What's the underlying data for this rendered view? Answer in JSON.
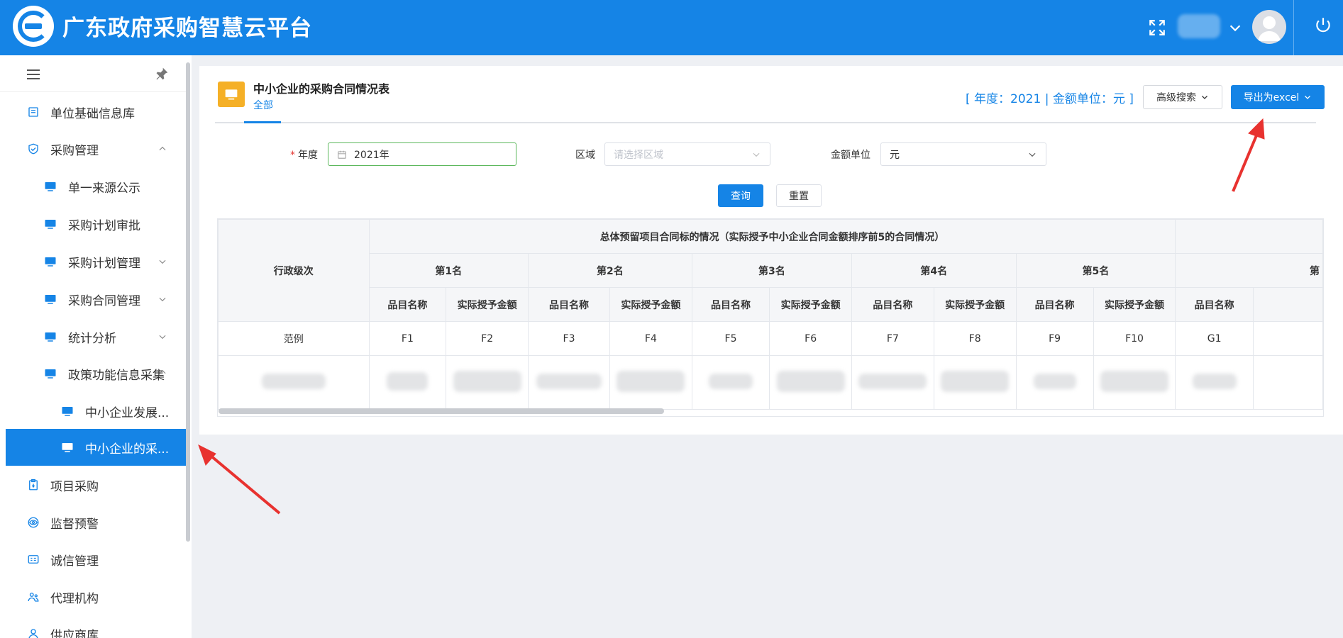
{
  "header": {
    "title": "广东政府采购智慧云平台",
    "icons": {
      "fullscreen": "fullscreen-icon",
      "chevron": "chevron-down-icon",
      "avatar": "avatar",
      "power": "power-icon"
    }
  },
  "sidebar": {
    "items": [
      {
        "label": "单位基础信息库",
        "icon": "building-icon"
      },
      {
        "label": "采购管理",
        "icon": "shield-icon"
      },
      {
        "label": "单一来源公示",
        "icon": "monitor-icon"
      },
      {
        "label": "采购计划审批",
        "icon": "monitor-icon"
      },
      {
        "label": "采购计划管理",
        "icon": "monitor-icon"
      },
      {
        "label": "采购合同管理",
        "icon": "monitor-icon"
      },
      {
        "label": "统计分析",
        "icon": "monitor-icon"
      },
      {
        "label": "政策功能信息采集",
        "icon": "monitor-icon"
      },
      {
        "label": "中小企业发展...",
        "icon": "monitor-icon"
      },
      {
        "label": "中小企业的采...",
        "icon": "monitor-icon"
      },
      {
        "label": "项目采购",
        "icon": "clipboard-icon"
      },
      {
        "label": "监督预警",
        "icon": "eye-icon"
      },
      {
        "label": "诚信管理",
        "icon": "card-icon"
      },
      {
        "label": "代理机构",
        "icon": "people-icon"
      },
      {
        "label": "供应商库",
        "icon": "person-icon"
      }
    ]
  },
  "page": {
    "title": "中小企业的采购合同情况表",
    "tab": "全部",
    "year_info": "[ 年度：2021 | 金额单位：元 ]",
    "advanced_search": "高级搜索",
    "export": "导出为excel"
  },
  "form": {
    "year_label": "年度",
    "year_required": "*",
    "year_value": "2021年",
    "region_label": "区域",
    "region_placeholder": "请选择区域",
    "unit_label": "金额单位",
    "unit_value": "元",
    "query": "查询",
    "reset": "重置"
  },
  "table": {
    "col_level": "行政级次",
    "group_title": "总体预留项目合同标的情况（实际授予中小企业合同金额排序前5的合同情况）",
    "ranks": [
      "第1名",
      "第2名",
      "第3名",
      "第4名",
      "第5名",
      "第"
    ],
    "sub_headers": [
      "品目名称",
      "实际授予金额"
    ],
    "example_row": [
      "范例",
      "F1",
      "F2",
      "F3",
      "F4",
      "F5",
      "F6",
      "F7",
      "F8",
      "F9",
      "F10",
      "G1"
    ]
  }
}
